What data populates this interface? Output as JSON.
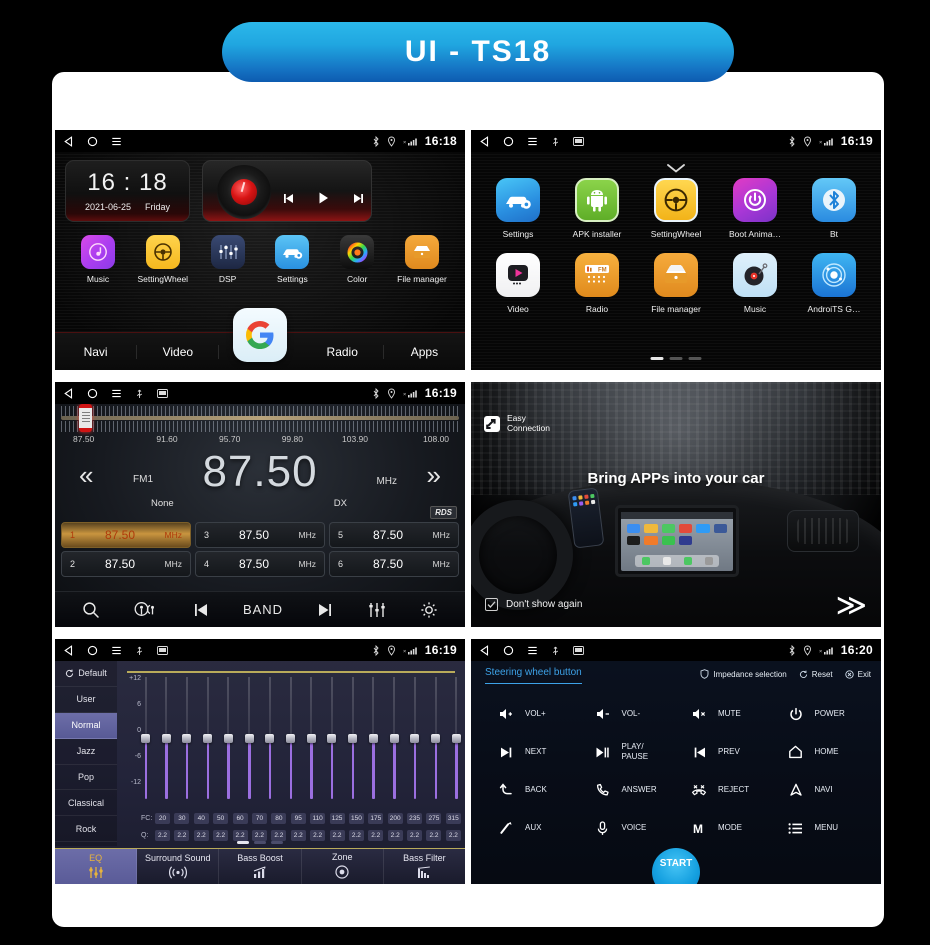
{
  "banner": {
    "title": "UI - TS18"
  },
  "statusbar": {
    "icons_left": [
      "back-triangle-icon",
      "home-circle-icon",
      "menu-lines-icon",
      "usb-icon",
      "sd-card-icon"
    ],
    "icons_right": [
      "bluetooth-icon",
      "location-icon",
      "signal-icon"
    ],
    "times": {
      "home": "16:18",
      "drawer": "16:19",
      "radio": "16:19",
      "eq": "16:19",
      "swc": "16:20"
    }
  },
  "home": {
    "clock": {
      "time": "16 : 18",
      "date": "2021-06-25",
      "weekday": "Friday"
    },
    "media": {
      "prev": "prev-track-icon",
      "play": "play-icon",
      "next": "next-track-icon"
    },
    "apps": [
      {
        "label": "Music",
        "icon": "music-note-icon"
      },
      {
        "label": "SettingWheel",
        "icon": "steering-wheel-icon"
      },
      {
        "label": "DSP",
        "icon": "equalizer-icon"
      },
      {
        "label": "Settings",
        "icon": "car-gear-icon"
      },
      {
        "label": "Color",
        "icon": "color-wheel-icon"
      },
      {
        "label": "File manager",
        "icon": "folder-icon"
      }
    ],
    "dock": [
      "Navi",
      "Video",
      "Radio",
      "Apps"
    ],
    "center_button": "google-icon"
  },
  "drawer": {
    "row1": [
      {
        "label": "Settings",
        "icon": "car-gear-icon"
      },
      {
        "label": "APK installer",
        "icon": "android-robot-icon"
      },
      {
        "label": "SettingWheel",
        "icon": "steering-wheel-icon"
      },
      {
        "label": "Boot Anima…",
        "icon": "power-icon"
      },
      {
        "label": "Bt",
        "icon": "bluetooth-icon"
      }
    ],
    "row2": [
      {
        "label": "Video",
        "icon": "play-video-icon"
      },
      {
        "label": "Radio",
        "icon": "fm-radio-icon"
      },
      {
        "label": "File manager",
        "icon": "folder-icon"
      },
      {
        "label": "Music",
        "icon": "turntable-icon"
      },
      {
        "label": "AndroiTS G…",
        "icon": "gps-radar-icon"
      }
    ],
    "page_dots": 3,
    "active_dot": 0
  },
  "radio": {
    "scale_labels": [
      "87.50",
      "91.60",
      "95.70",
      "99.80",
      "103.90",
      "108.00"
    ],
    "frequency": "87.50",
    "band": "FM1",
    "unit": "MHz",
    "pty": "None",
    "mode": "DX",
    "rds": "RDS",
    "prev_arrow": "«",
    "next_arrow": "»",
    "presets": [
      {
        "num": "1",
        "value": "87.50",
        "unit": "MHz",
        "active": true
      },
      {
        "num": "3",
        "value": "87.50",
        "unit": "MHz",
        "active": false
      },
      {
        "num": "5",
        "value": "87.50",
        "unit": "MHz",
        "active": false
      },
      {
        "num": "2",
        "value": "87.50",
        "unit": "MHz",
        "active": false
      },
      {
        "num": "4",
        "value": "87.50",
        "unit": "MHz",
        "active": false
      },
      {
        "num": "6",
        "value": "87.50",
        "unit": "MHz",
        "active": false
      }
    ],
    "toolbar": {
      "search": "search-icon",
      "antenna": "radio-antenna-icon",
      "prev": "prev-track-icon",
      "band_label": "BAND",
      "next": "next-track-icon",
      "eq": "equalizer-icon",
      "settings": "gear-icon"
    }
  },
  "easy": {
    "logo_line1": "Easy",
    "logo_line2": "Connection",
    "headline": "Bring APPs into your car",
    "dont_show": "Don't show again",
    "next_arrow": "≫"
  },
  "eq": {
    "presets": [
      {
        "label": "Default",
        "active": false,
        "icon": "refresh-icon"
      },
      {
        "label": "User",
        "active": false
      },
      {
        "label": "Normal",
        "active": true
      },
      {
        "label": "Jazz",
        "active": false
      },
      {
        "label": "Pop",
        "active": false
      },
      {
        "label": "Classical",
        "active": false
      },
      {
        "label": "Rock",
        "active": false
      }
    ],
    "y_axis": [
      "+12",
      "6",
      "0",
      "-6",
      "-12"
    ],
    "fc_label": "FC:",
    "q_label": "Q:",
    "fc_values": [
      "20",
      "30",
      "40",
      "50",
      "60",
      "70",
      "80",
      "95",
      "110",
      "125",
      "150",
      "175",
      "200",
      "235",
      "275",
      "315"
    ],
    "q_values": [
      "2.2",
      "2.2",
      "2.2",
      "2.2",
      "2.2",
      "2.2",
      "2.2",
      "2.2",
      "2.2",
      "2.2",
      "2.2",
      "2.2",
      "2.2",
      "2.2",
      "2.2",
      "2.2"
    ],
    "band_gains": [
      0,
      0,
      0,
      0,
      0,
      0,
      0,
      0,
      0,
      0,
      0,
      0,
      0,
      0,
      0,
      0
    ],
    "tabs": [
      {
        "label": "EQ",
        "glyph": "⦀",
        "active": true
      },
      {
        "label": "Surround Sound",
        "glyph": "((·))",
        "active": false
      },
      {
        "label": "Bass Boost",
        "glyph": "◢",
        "active": false
      },
      {
        "label": "Zone",
        "glyph": "⊙",
        "active": false
      },
      {
        "label": "Bass Filter",
        "glyph": "▐",
        "active": false
      }
    ],
    "page_dots": 3,
    "active_dot": 0
  },
  "swc": {
    "title": "Steering wheel button",
    "actions": [
      {
        "label": "Impedance selection",
        "icon": "shield-icon"
      },
      {
        "label": "Reset",
        "icon": "refresh-icon"
      },
      {
        "label": "Exit",
        "icon": "exit-icon"
      }
    ],
    "buttons": [
      {
        "label": "VOL+",
        "icon": "volume-up-icon"
      },
      {
        "label": "VOL-",
        "icon": "volume-down-icon"
      },
      {
        "label": "MUTE",
        "icon": "volume-mute-icon"
      },
      {
        "label": "POWER",
        "icon": "power-icon"
      },
      {
        "label": "NEXT",
        "icon": "next-track-icon"
      },
      {
        "label": "PLAY/\nPAUSE",
        "icon": "play-pause-icon"
      },
      {
        "label": "PREV",
        "icon": "prev-track-icon"
      },
      {
        "label": "HOME",
        "icon": "home-icon"
      },
      {
        "label": "BACK",
        "icon": "back-arrow-icon"
      },
      {
        "label": "ANSWER",
        "icon": "phone-answer-icon"
      },
      {
        "label": "REJECT",
        "icon": "phone-reject-icon"
      },
      {
        "label": "NAVI",
        "icon": "navigation-icon"
      },
      {
        "label": "AUX",
        "icon": "aux-plug-icon"
      },
      {
        "label": "VOICE",
        "icon": "microphone-icon"
      },
      {
        "label": "MODE",
        "icon": "mode-m-icon"
      },
      {
        "label": "MENU",
        "icon": "menu-list-icon"
      }
    ],
    "start_label": "START"
  }
}
